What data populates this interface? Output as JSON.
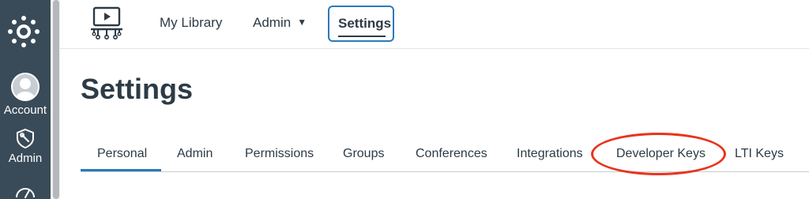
{
  "global_nav": {
    "account_label": "Account",
    "admin_label": "Admin",
    "bg_color": "#394b58"
  },
  "topbar": {
    "items": [
      {
        "label": "My Library"
      },
      {
        "label": "Admin"
      },
      {
        "label": "Settings"
      }
    ],
    "active_item": "Settings",
    "accent_color": "#2b7abc"
  },
  "page": {
    "title": "Settings"
  },
  "tabs": {
    "items": [
      {
        "label": "Personal"
      },
      {
        "label": "Admin"
      },
      {
        "label": "Permissions"
      },
      {
        "label": "Groups"
      },
      {
        "label": "Conferences"
      },
      {
        "label": "Integrations"
      },
      {
        "label": "Developer Keys"
      },
      {
        "label": "LTI Keys"
      }
    ],
    "active": "Personal",
    "highlighted": "Developer Keys",
    "highlight_color": "#e8341c"
  }
}
